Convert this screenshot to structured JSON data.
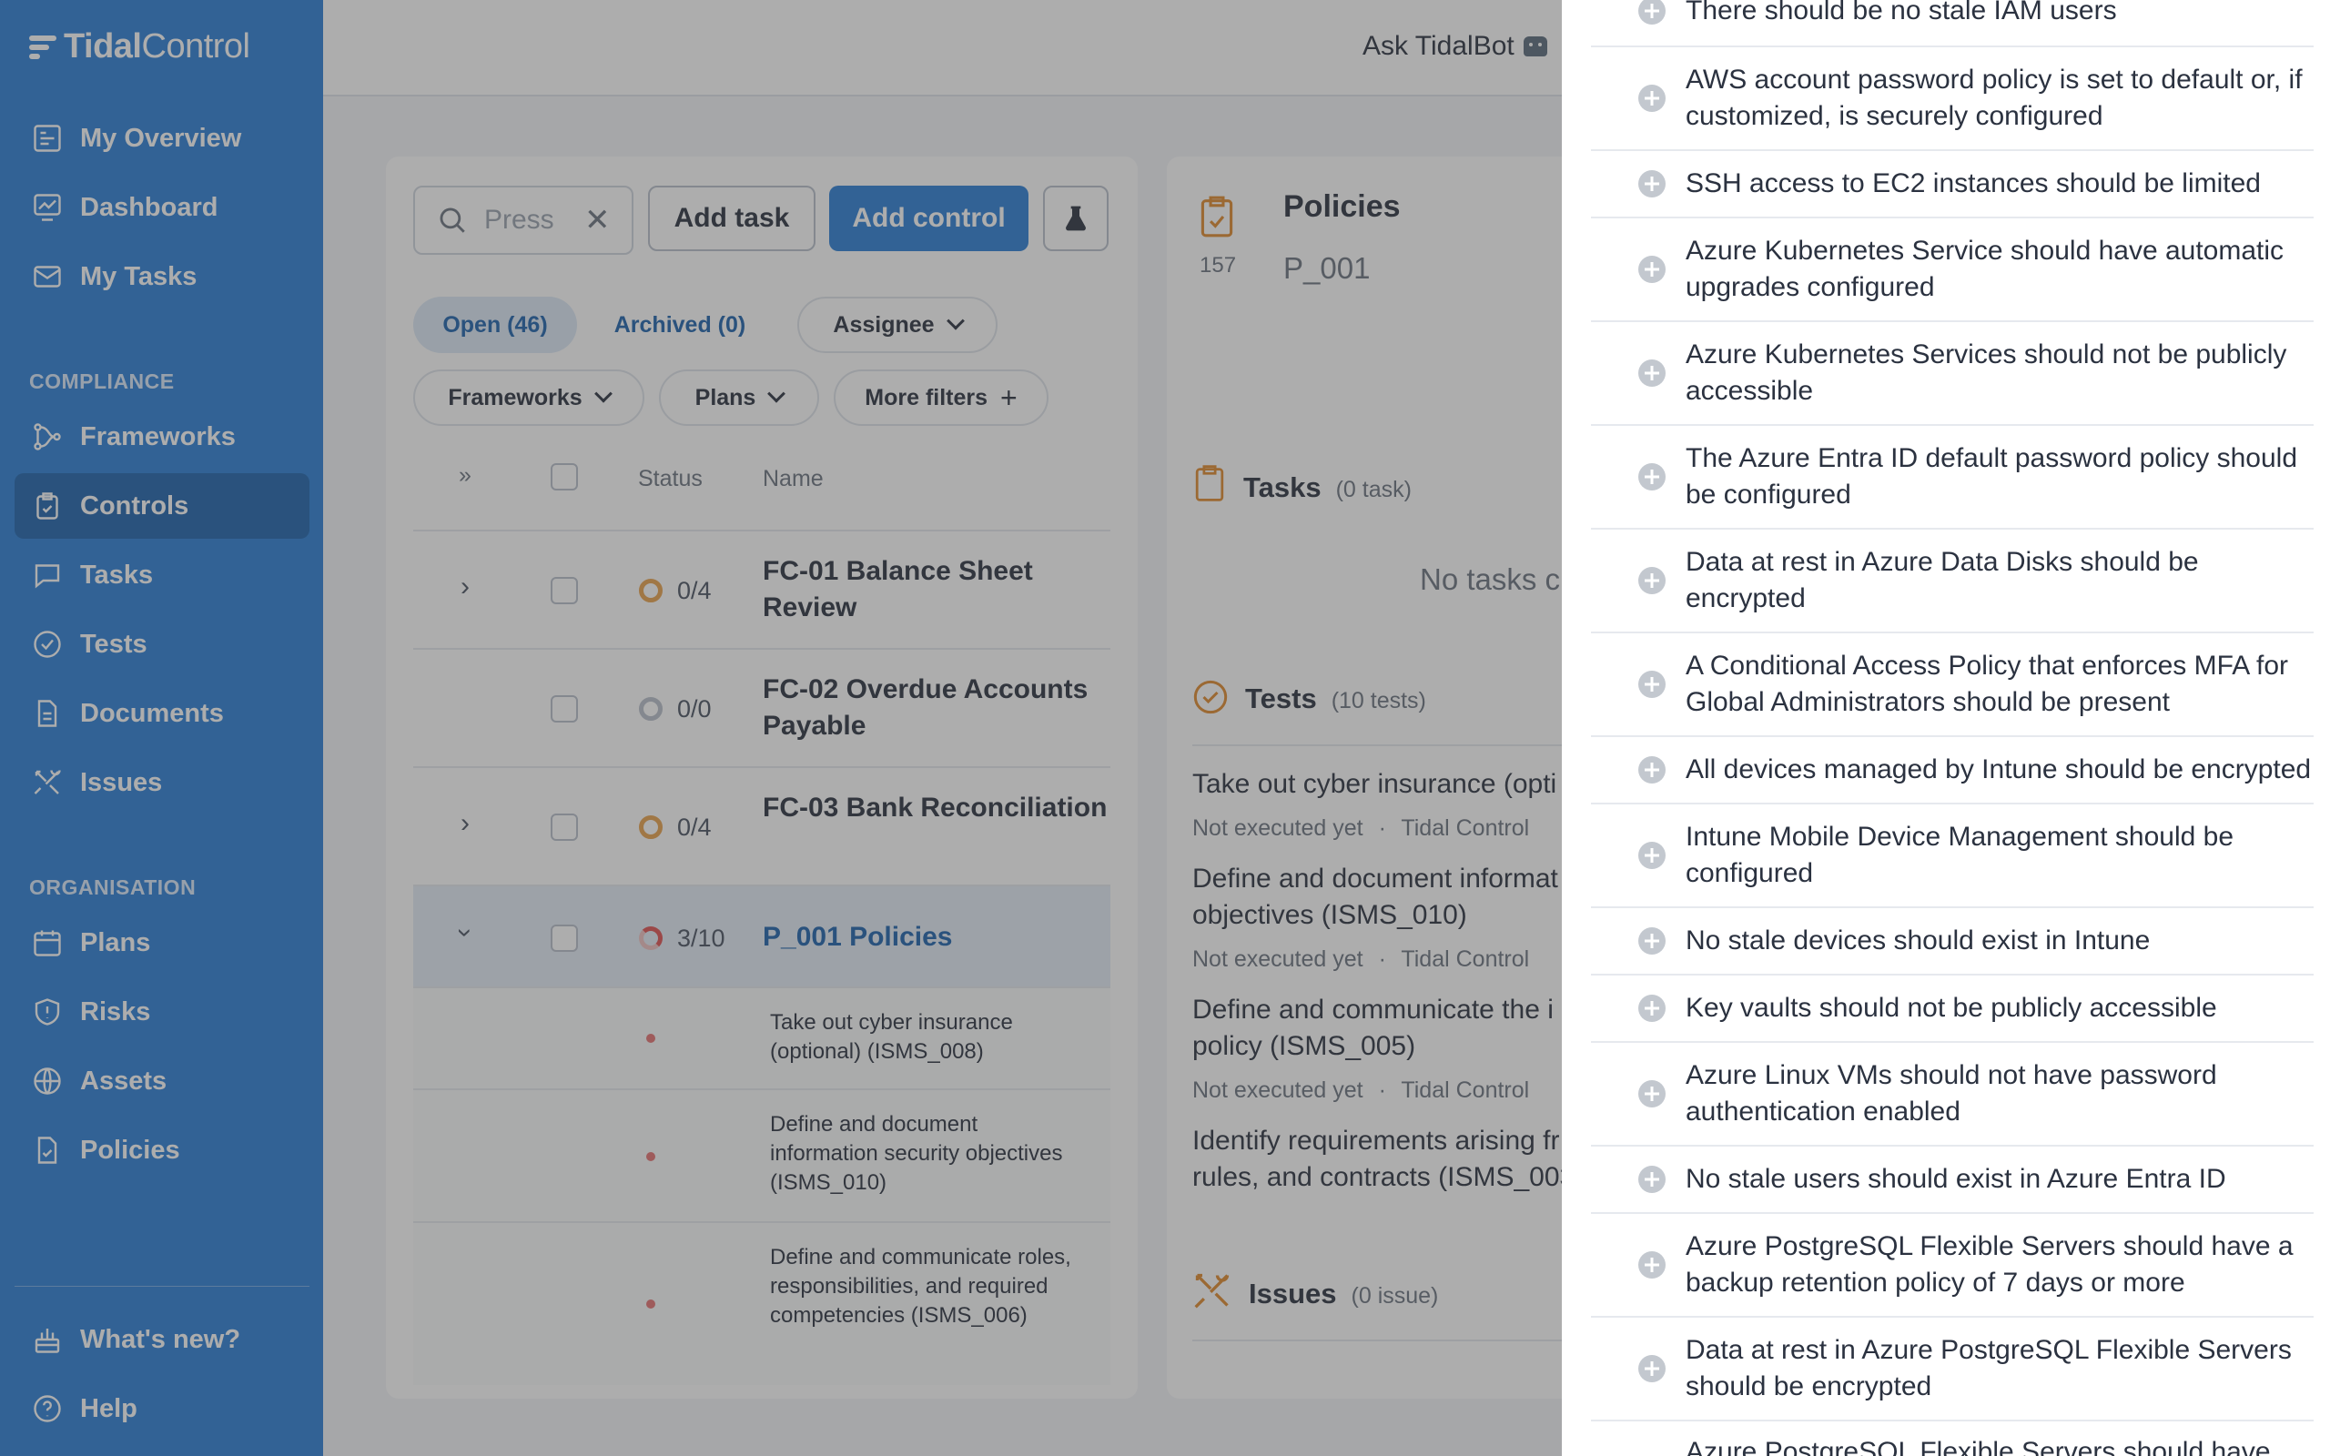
{
  "app": {
    "logo_bold": "Tidal",
    "logo_light": "Control"
  },
  "sidebar": {
    "top_items": [
      {
        "label": "My Overview",
        "icon": "overview-icon"
      },
      {
        "label": "Dashboard",
        "icon": "dashboard-icon"
      },
      {
        "label": "My Tasks",
        "icon": "mail-icon"
      }
    ],
    "compliance_label": "COMPLIANCE",
    "compliance_items": [
      {
        "label": "Frameworks",
        "icon": "frameworks-icon"
      },
      {
        "label": "Controls",
        "icon": "controls-icon",
        "active": true
      },
      {
        "label": "Tasks",
        "icon": "chat-icon"
      },
      {
        "label": "Tests",
        "icon": "check-circle-icon"
      },
      {
        "label": "Documents",
        "icon": "document-icon"
      },
      {
        "label": "Issues",
        "icon": "tools-icon"
      }
    ],
    "organisation_label": "ORGANISATION",
    "organisation_items": [
      {
        "label": "Plans",
        "icon": "calendar-icon"
      },
      {
        "label": "Risks",
        "icon": "shield-icon"
      },
      {
        "label": "Assets",
        "icon": "globe-icon"
      },
      {
        "label": "Policies",
        "icon": "policy-icon"
      }
    ],
    "bottom_items": [
      {
        "label": "What's new?",
        "icon": "cake-icon"
      },
      {
        "label": "Help",
        "icon": "help-icon"
      }
    ]
  },
  "topbar": {
    "ask_bot": "Ask TidalBot"
  },
  "controls": {
    "search_placeholder": "Press",
    "add_task": "Add task",
    "add_control": "Add control",
    "tabs": {
      "open": "Open (46)",
      "archived": "Archived (0)"
    },
    "filters": {
      "assignee": "Assignee",
      "frameworks": "Frameworks",
      "plans": "Plans",
      "more": "More filters"
    },
    "columns": {
      "expand": "»",
      "status": "Status",
      "name": "Name"
    },
    "rows": [
      {
        "count": "0/4",
        "name": "FC-01 Balance Sheet Review",
        "expandable": true
      },
      {
        "count": "0/0",
        "name": "FC-02 Overdue Accounts Payable",
        "expandable": false
      },
      {
        "count": "0/4",
        "name": "FC-03 Bank Reconciliation",
        "expandable": true
      },
      {
        "count": "3/10",
        "name": "P_001 Policies",
        "expandable": true,
        "selected": true
      }
    ],
    "subrows": [
      {
        "name": "Take out cyber insurance (optional) (ISMS_008)"
      },
      {
        "name": "Define and document information security objectives (ISMS_010)"
      },
      {
        "name": "Define and communicate roles, responsibilities, and required competencies (ISMS_006)"
      }
    ]
  },
  "detail": {
    "title": "Policies",
    "id": "P_001",
    "number": "157",
    "tasks_label": "Tasks",
    "tasks_count": "(0 task)",
    "tasks_empty": "No tasks c",
    "tests_label": "Tests",
    "tests_count": "(10 tests)",
    "tests": [
      {
        "line1": "Take out cyber insurance (opti",
        "line2": "",
        "status": "Not executed yet",
        "owner": "Tidal Control"
      },
      {
        "line1": "Define and document informat",
        "line2": "objectives (ISMS_010)",
        "status": "Not executed yet",
        "owner": "Tidal Control"
      },
      {
        "line1": "Define and communicate the i",
        "line2": "policy (ISMS_005)",
        "status": "Not executed yet",
        "owner": "Tidal Control"
      },
      {
        "line1": "Identify requirements arising fr",
        "line2": "rules, and contracts (ISMS_003",
        "status": "",
        "owner": ""
      }
    ],
    "issues_label": "Issues",
    "issues_count": "(0 issue)"
  },
  "drawer": {
    "items": [
      "There should be no stale IAM users",
      "AWS account password policy is set to default or, if customized, is securely configured",
      "SSH access to EC2 instances should be limited",
      "Azure Kubernetes Service should have automatic upgrades configured",
      "Azure Kubernetes Services should not be publicly accessible",
      "The Azure Entra ID default password policy should be configured",
      "Data at rest in Azure Data Disks should be encrypted",
      "A Conditional Access Policy that enforces MFA for Global Administrators should be present",
      "All devices managed by Intune should be encrypted",
      "Intune Mobile Device Management should be configured",
      "No stale devices should exist in Intune",
      "Key vaults should not be publicly accessible",
      "Azure Linux VMs should not have password authentication enabled",
      "No stale users should exist in Azure Entra ID",
      "Azure PostgreSQL Flexible Servers should have a backup retention policy of 7 days or more",
      "Data at rest in Azure PostgreSQL Flexible Servers should be encrypted",
      "Azure PostgreSQL Flexible Servers should have"
    ]
  }
}
